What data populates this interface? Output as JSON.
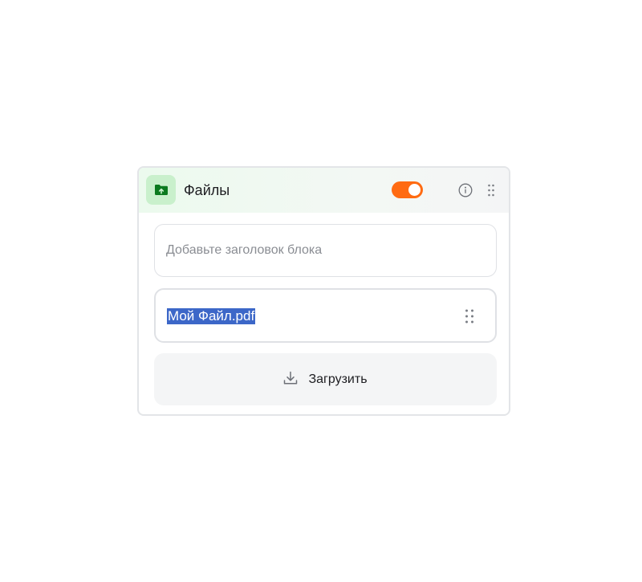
{
  "block": {
    "title": "Файлы",
    "icon": "folder-upload-icon",
    "enabled": true,
    "accent_color": "#ff6b12",
    "icon_badge_color": "#c9f0cc",
    "icon_color": "#0a7a1e"
  },
  "title_field": {
    "value": "",
    "placeholder": "Добавьте заголовок блока"
  },
  "files": [
    {
      "name": "Мой Файл.pdf",
      "selected": true
    }
  ],
  "upload": {
    "label": "Загрузить",
    "icon": "download-icon"
  }
}
